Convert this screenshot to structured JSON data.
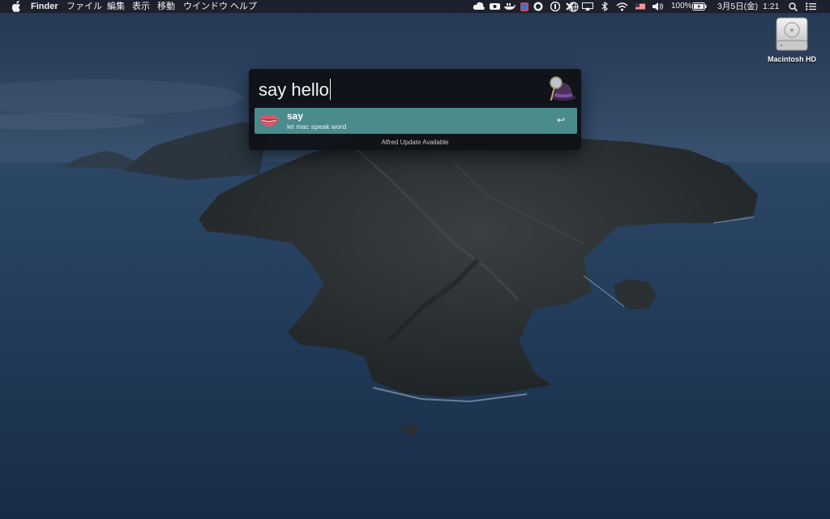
{
  "menubar": {
    "app_name": "Finder",
    "menus": [
      "ファイル",
      "編集",
      "表示",
      "移動",
      "ウインドウ",
      "ヘルプ"
    ],
    "battery_percent": "100%",
    "datetime": "3月5日(金)  1:21",
    "status_icons": [
      "cloud-icon",
      "camera-icon",
      "docker-icon",
      "flag-icon",
      "app-icon",
      "onepassword-icon",
      "tools-icon",
      "globe-icon",
      "airplay-icon",
      "bluetooth-icon",
      "wifi-icon",
      "us-flag-icon",
      "volume-icon",
      "battery-icon",
      "spotlight-icon",
      "control-list-icon"
    ]
  },
  "desktop": {
    "drive_label": "Macintosh HD"
  },
  "alfred": {
    "query": "say hello",
    "results": [
      {
        "title": "say",
        "subtitle": "let mac speak word",
        "icon": "lips-icon",
        "action": "↩"
      }
    ],
    "footer": "Alfred Update Available"
  },
  "colors": {
    "result_highlight": "#4b8b8c",
    "alfred_background": "#0e1014",
    "menubar_background": "#1c1e2a"
  }
}
